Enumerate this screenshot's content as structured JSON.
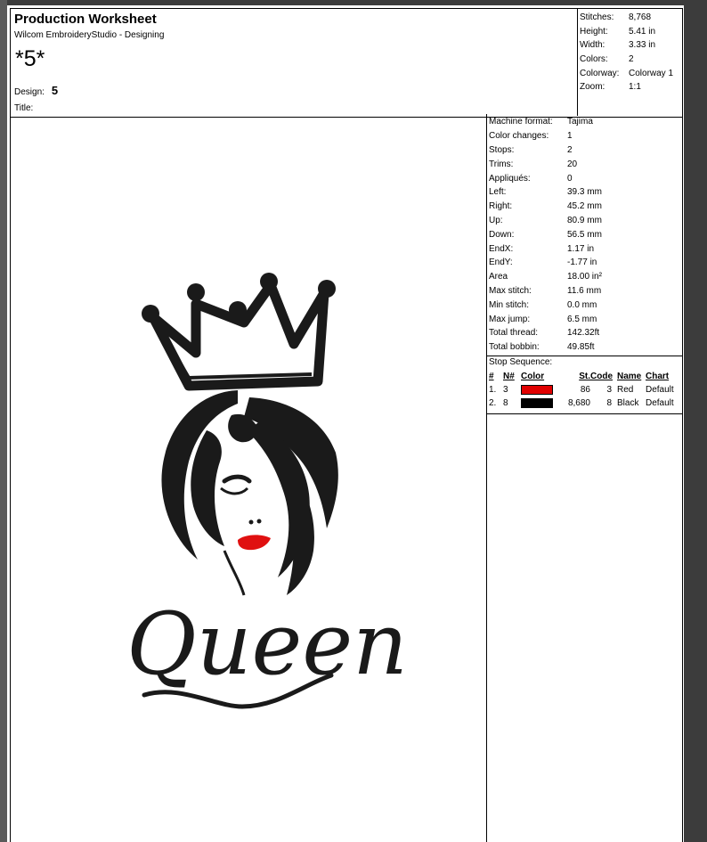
{
  "header": {
    "title": "Production Worksheet",
    "software": "Wilcom EmbroideryStudio - Designing",
    "design_name": "*5*",
    "design_label": "Design:",
    "design_value": "5",
    "title_label": "Title:"
  },
  "summary": [
    {
      "label": "Stitches:",
      "value": "8,768"
    },
    {
      "label": "Height:",
      "value": "5.41 in"
    },
    {
      "label": "Width:",
      "value": "3.33 in"
    },
    {
      "label": "Colors:",
      "value": "2"
    },
    {
      "label": "Colorway:",
      "value": "Colorway 1"
    },
    {
      "label": "Zoom:",
      "value": "1:1"
    }
  ],
  "stats": [
    {
      "label": "Machine format:",
      "value": "Tajima"
    },
    {
      "label": "Color changes:",
      "value": "1"
    },
    {
      "label": "Stops:",
      "value": "2"
    },
    {
      "label": "Trims:",
      "value": "20"
    },
    {
      "label": "Appliqués:",
      "value": "0"
    },
    {
      "label": "Left:",
      "value": "39.3 mm"
    },
    {
      "label": "Right:",
      "value": "45.2 mm"
    },
    {
      "label": "Up:",
      "value": "80.9 mm"
    },
    {
      "label": "Down:",
      "value": "56.5 mm"
    },
    {
      "label": "EndX:",
      "value": "1.17 in"
    },
    {
      "label": "EndY:",
      "value": "-1.77 in"
    },
    {
      "label": "Area",
      "value": " 18.00 in²"
    },
    {
      "label": "Max stitch:",
      "value": "11.6 mm"
    },
    {
      "label": "Min stitch:",
      "value": "0.0 mm"
    },
    {
      "label": "Max jump:",
      "value": "6.5 mm"
    },
    {
      "label": "Total thread:",
      "value": "142.32ft"
    },
    {
      "label": "Total bobbin:",
      "value": "49.85ft"
    }
  ],
  "stop_sequence": {
    "title": "Stop Sequence:",
    "headers": {
      "num": "#",
      "n": "N#",
      "color": "Color",
      "st": "St.",
      "code": "Code",
      "name": "Name",
      "chart": "Chart"
    },
    "rows": [
      {
        "num": "1.",
        "n": "3",
        "color": "#e00000",
        "st": "86",
        "code": "3",
        "name": "Red",
        "chart": "Default"
      },
      {
        "num": "2.",
        "n": "8",
        "color": "#000000",
        "st": "8,680",
        "code": "8",
        "name": "Black",
        "chart": "Default"
      }
    ]
  },
  "artwork": {
    "text": "Queen",
    "thread_black": "#1a1a1a",
    "thread_red": "#e01010"
  }
}
